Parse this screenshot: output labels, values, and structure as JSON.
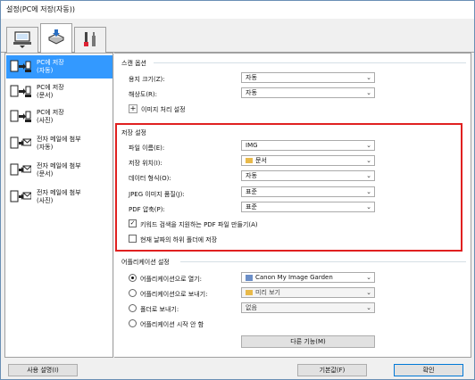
{
  "window": {
    "title": "설정(PC에 저장(자동))"
  },
  "tabs": [
    {
      "icon": "computer-icon"
    },
    {
      "icon": "scanner-icon"
    },
    {
      "icon": "tools-icon"
    }
  ],
  "sidebar": {
    "items": [
      {
        "line1": "PC에 저장",
        "line2": "(자동)",
        "icon": "scan-to-pc-icon"
      },
      {
        "line1": "PC에 저장",
        "line2": "(문서)",
        "icon": "scan-to-pc-icon"
      },
      {
        "line1": "PC에 저장",
        "line2": "(사진)",
        "icon": "scan-to-pc-icon"
      },
      {
        "line1": "전자 메일에 첨부",
        "line2": "(자동)",
        "icon": "mail-icon"
      },
      {
        "line1": "전자 메일에 첨부",
        "line2": "(문서)",
        "icon": "mail-icon"
      },
      {
        "line1": "전자 메일에 첨부",
        "line2": "(사진)",
        "icon": "mail-icon"
      }
    ]
  },
  "scan_options": {
    "title": "스캔 옵션",
    "paper_size_label": "용지 크기(Z):",
    "paper_size_value": "자동",
    "resolution_label": "해상도(R):",
    "resolution_value": "자동",
    "image_processing_label": "이미지 처리 설정"
  },
  "save_settings": {
    "title": "저장 설정",
    "file_name_label": "파일 이름(E):",
    "file_name_value": "IMG",
    "save_in_label": "저장 위치(I):",
    "save_in_value": "문서",
    "data_format_label": "데이터 형식(O):",
    "data_format_value": "자동",
    "jpeg_quality_label": "JPEG 이미지 품질(J):",
    "jpeg_quality_value": "표준",
    "pdf_compression_label": "PDF 압축(P):",
    "pdf_compression_value": "표준",
    "keyword_pdf_label": "키워드 검색을 지원하는 PDF 파일 만들기(A)",
    "keyword_pdf_checked": true,
    "subfolder_label": "현재 날짜의 하위 폴더에 저장",
    "subfolder_checked": false
  },
  "app_settings": {
    "title": "어플리케이션 설정",
    "open_with_label": "어플리케이션으로 열기:",
    "open_with_value": "Canon My Image Garden",
    "send_to_app_label": "어플리케이션으로 보내기:",
    "send_to_app_value": "미리 보기",
    "send_to_folder_label": "폴더로 보내기:",
    "send_to_folder_value": "없음",
    "do_not_start_label": "어플리케이션 시작 안 함",
    "more_functions_label": "다른 기능(M)",
    "selected_option": "open_with"
  },
  "footer": {
    "instructions_label": "사용 설명(I)",
    "defaults_label": "기본값(F)",
    "ok_label": "확인"
  }
}
